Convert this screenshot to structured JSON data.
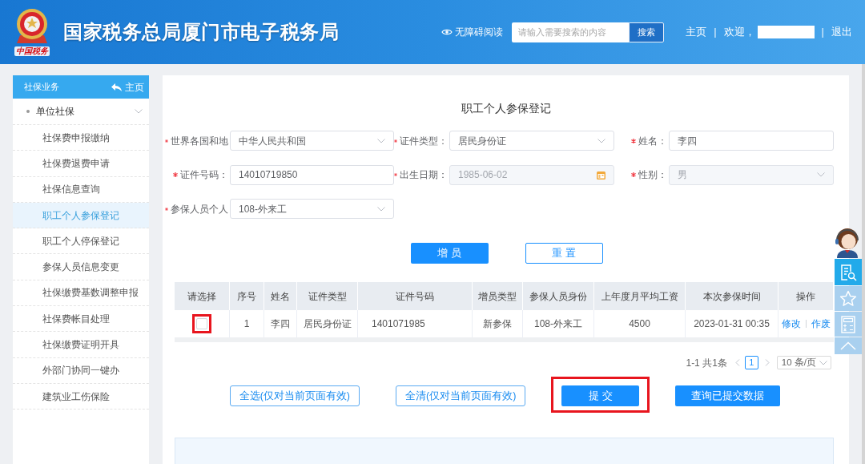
{
  "header": {
    "logo_text": "中国税务",
    "title": "国家税务总局厦门市电子税务局",
    "accessibility_link": "无障碍阅读",
    "search": {
      "placeholder": "请输入需要搜索的内容",
      "button": "搜索"
    },
    "nav": [
      {
        "kind": "link",
        "label": "主页"
      },
      {
        "kind": "separator",
        "label": "|"
      },
      {
        "kind": "text",
        "label": "欢迎，"
      },
      {
        "kind": "redacted"
      },
      {
        "kind": "separator",
        "label": "|"
      },
      {
        "kind": "link",
        "label": "退出"
      }
    ]
  },
  "sidebar": {
    "title": "社保业务",
    "home_link": "主页",
    "groups": [
      {
        "label": "单位社保",
        "expanded": true,
        "children": [
          {
            "label": "社保费申报缴纳",
            "selected": false
          },
          {
            "label": "社保费退费申请",
            "selected": false
          },
          {
            "label": "社保信息查询",
            "selected": false
          },
          {
            "label": "职工个人参保登记",
            "selected": true
          },
          {
            "label": "职工个人停保登记",
            "selected": false
          },
          {
            "label": "参保人员信息变更",
            "selected": false
          },
          {
            "label": "社保缴费基数调整申报",
            "selected": false
          },
          {
            "label": "社保费帐目处理",
            "selected": false
          },
          {
            "label": "社保缴费证明开具",
            "selected": false
          },
          {
            "label": "外部门协同一键办",
            "selected": false
          },
          {
            "label": "建筑业工伤保险",
            "selected": false
          }
        ]
      }
    ]
  },
  "form": {
    "title": "职工个人参保登记",
    "rows": [
      [
        {
          "label": "世界各国和地",
          "kind": "select",
          "value": "中华人民共和国",
          "required": true,
          "disabled": false
        },
        {
          "label": "证件类型：",
          "kind": "select",
          "value": "居民身份证",
          "required": true,
          "disabled": false
        },
        {
          "label": "姓名：",
          "kind": "input",
          "value": "李四",
          "required": true,
          "disabled": false
        }
      ],
      [
        {
          "label": "证件号码：",
          "kind": "input",
          "value": "14010719850",
          "required": true,
          "disabled": false
        },
        {
          "label": "出生日期：",
          "kind": "date",
          "value": "1985-06-02",
          "required": true,
          "disabled": true
        },
        {
          "label": "性别：",
          "kind": "select",
          "value": "男",
          "required": true,
          "disabled": true
        }
      ],
      [
        {
          "label": "参保人员个人",
          "kind": "select",
          "value": "108-外来工",
          "required": true,
          "disabled": false
        }
      ]
    ],
    "buttons": [
      {
        "label": "增员",
        "kind": "primary"
      },
      {
        "label": "重置",
        "kind": "outline"
      }
    ]
  },
  "table": {
    "select_column": "请选择",
    "columns": [
      "序号",
      "姓名",
      "证件类型",
      "证件号码",
      "增员类型",
      "参保人员身份",
      "上年度月平均工资",
      "本次参保时间",
      "操作"
    ],
    "rows": [
      {
        "checked": false,
        "highlighted": true,
        "cells": [
          "1",
          "李四",
          "居民身份证",
          "1401071985",
          "新参保",
          "108-外来工",
          "4500",
          "2023-01-31 00:35"
        ],
        "actions": [
          "修改",
          "作废"
        ]
      }
    ]
  },
  "pagination": {
    "summary": "1-1 共1条",
    "pages": [
      {
        "label": "1",
        "selected": true
      }
    ],
    "page_size": "10 条/页"
  },
  "action_buttons": [
    {
      "label": "全选(仅对当前页面有效)",
      "kind": "outline",
      "highlighted": false
    },
    {
      "label": "全清(仅对当前页面有效)",
      "kind": "outline",
      "highlighted": false
    },
    {
      "label": "提 交",
      "kind": "primary",
      "highlighted": true
    },
    {
      "label": "查询已提交数据",
      "kind": "primary",
      "highlighted": false
    }
  ],
  "float_toolbar": [
    {
      "kind": "avatar"
    },
    {
      "kind": "doc-search",
      "active": true
    },
    {
      "kind": "star",
      "active": false
    },
    {
      "kind": "calculator",
      "active": false
    },
    {
      "kind": "up",
      "active": false
    }
  ]
}
